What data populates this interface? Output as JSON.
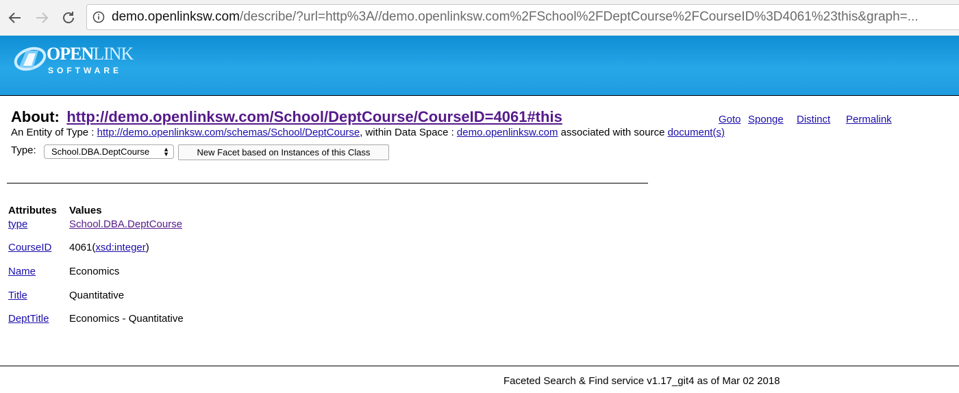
{
  "browser": {
    "url_host": "demo.openlinksw.com",
    "url_rest": "/describe/?url=http%3A//demo.openlinksw.com%2FSchool%2FDeptCourse%2FCourseID%3D4061%23this&graph=..."
  },
  "logo": {
    "word_open": "OPEN",
    "word_link": "LINK",
    "sub": "SOFTWARE"
  },
  "about": {
    "label": "About:",
    "link": "http://demo.openlinksw.com/School/DeptCourse/CourseID=4061#this",
    "links": [
      {
        "label": "Goto"
      },
      {
        "label": "Sponge"
      },
      {
        "label": "Distinct"
      },
      {
        "label": "Permalink"
      }
    ]
  },
  "entity": {
    "prefix": "An Entity of Type :",
    "type_link": "http://demo.openlinksw.com/schemas/School/DeptCourse",
    "within": ", within Data Space :",
    "space_link": "demo.openlinksw.com",
    "assoc": "associated with source",
    "source_link": "document(s)"
  },
  "type_row": {
    "label": "Type:",
    "selected": "School.DBA.DeptCourse",
    "button": "New Facet based on Instances of this Class"
  },
  "attributes": {
    "head_attr": "Attributes",
    "head_val": "Values",
    "rows": [
      {
        "key": "type",
        "value_link": "School.DBA.DeptCourse"
      },
      {
        "key": "CourseID",
        "value": "4061",
        "paren_open": "(",
        "value_link": "xsd:integer",
        "paren_close": ")"
      },
      {
        "key": "Name",
        "value": "Economics"
      },
      {
        "key": "Title",
        "value": "Quantitative"
      },
      {
        "key": "DeptTitle",
        "value": "Economics - Quantitative"
      }
    ]
  },
  "footer": "Faceted Search & Find service v1.17_git4 as of Mar 02 2018"
}
